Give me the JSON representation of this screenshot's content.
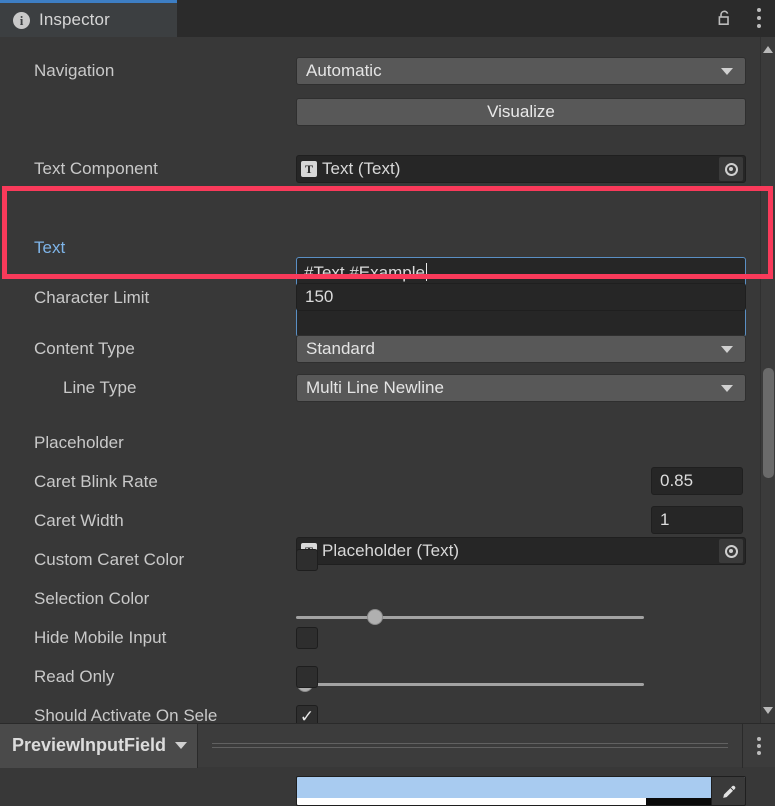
{
  "window": {
    "tab_label": "Inspector",
    "tab_icon": "info-icon",
    "lock_icon": "unlocked-padlock-icon",
    "menu_icon": "kebab-menu-icon",
    "accent_color": "#3d7ec4"
  },
  "annotation": {
    "color": "#f93a5a",
    "target": "Text"
  },
  "inspector": {
    "rows": [
      {
        "label": "Navigation",
        "type": "popup",
        "value": "Automatic"
      },
      {
        "label": "",
        "type": "button",
        "value": "Visualize"
      },
      {
        "label": "Text Component",
        "type": "object",
        "value": "Text (Text)",
        "badge": "T"
      },
      {
        "label": "Text",
        "type": "textarea",
        "value": "#Text #Example",
        "focused": true
      },
      {
        "label": "Character Limit",
        "type": "input",
        "value": "150"
      },
      {
        "label": "Content Type",
        "type": "popup",
        "value": "Standard"
      },
      {
        "label": "Line Type",
        "type": "popup",
        "value": "Multi Line Newline",
        "indent": true
      },
      {
        "label": "Placeholder",
        "type": "object",
        "value": "Placeholder (Text)",
        "badge": "T"
      },
      {
        "label": "Caret Blink Rate",
        "type": "slider",
        "value": "0.85",
        "fraction": 0.225
      },
      {
        "label": "Caret Width",
        "type": "slider",
        "value": "1",
        "fraction": 0.013
      },
      {
        "label": "Custom Caret Color",
        "type": "checkbox",
        "checked": false
      },
      {
        "label": "Selection Color",
        "type": "color",
        "swatch": "#a8cbf0",
        "alpha": 0.78,
        "eyedropper": "eyedropper-icon"
      },
      {
        "label": "Hide Mobile Input",
        "type": "checkbox",
        "checked": false
      },
      {
        "label": "Read Only",
        "type": "checkbox",
        "checked": false
      },
      {
        "label": "Should Activate On Sele",
        "type": "checkbox",
        "checked": true,
        "check_glyph": "✓"
      }
    ]
  },
  "statusbar": {
    "object_name": "PreviewInputField",
    "menu_icon": "kebab-menu-icon"
  },
  "scrollbar": {
    "up_icon": "scroll-up-arrow-icon",
    "down_icon": "scroll-down-arrow-icon"
  }
}
